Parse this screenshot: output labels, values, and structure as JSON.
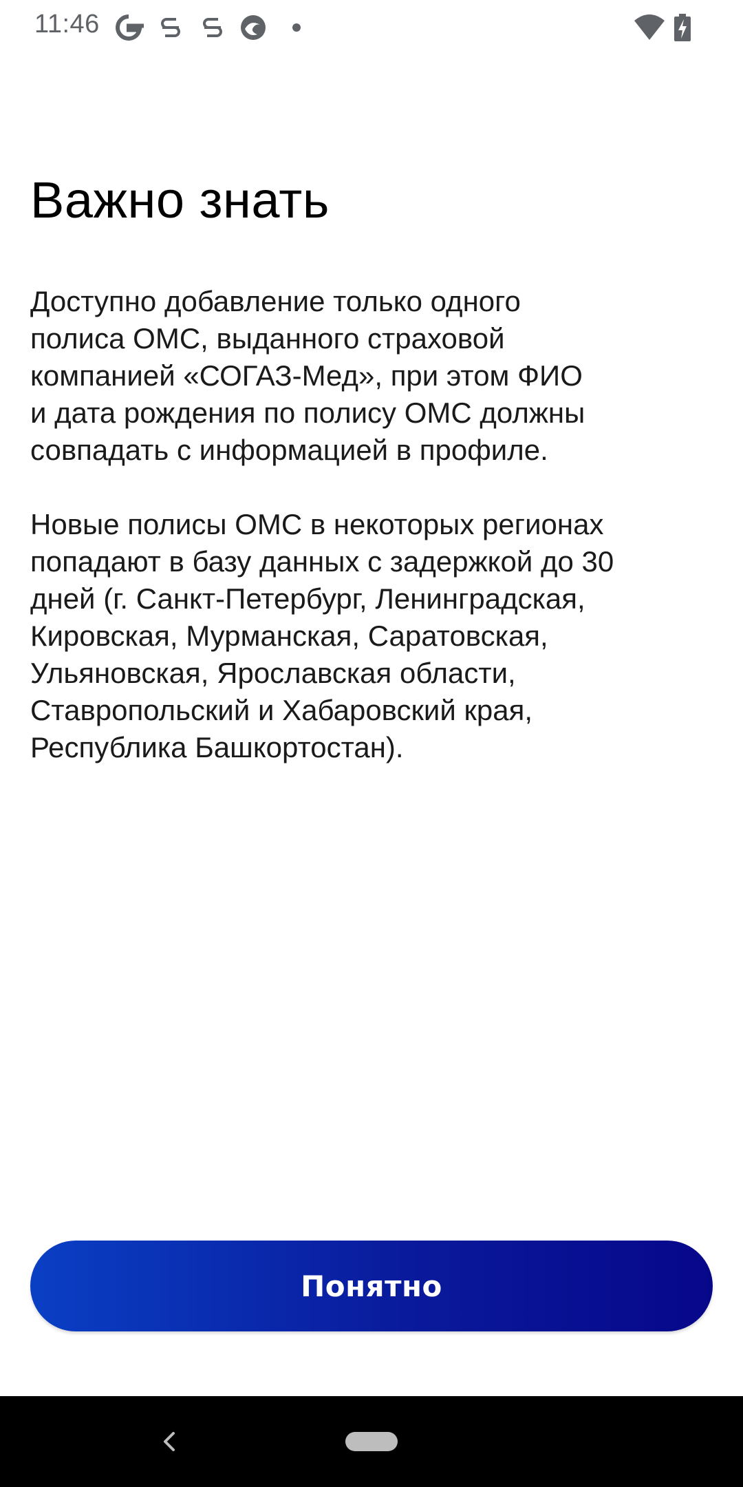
{
  "status_bar": {
    "time": "11:46",
    "icons": [
      "google-icon",
      "s-app-icon",
      "s-app-icon",
      "edge-icon",
      "notification-dot-icon",
      "wifi-icon",
      "battery-charging-icon"
    ]
  },
  "screen": {
    "title": "Важно знать",
    "paragraph_1": "Доступно добавление только одного\nполиса ОМС, выданного страховой\nкомпанией «СОГАЗ-Мед», при этом ФИО\nи дата рождения по полису ОМС должны\nсовпадать с информацией в профиле.",
    "paragraph_2": "Новые полисы ОМС в некоторых регионах\nпопадают в базу данных с задержкой до 30\nдней (г. Санкт-Петербург, Ленинградская,\nКировская, Мурманская, Саратовская,\nУльяновская, Ярославская области,\nСтавропольский и Хабаровский края,\nРеспублика Башкортостан).",
    "button_label": "Понятно"
  },
  "colors": {
    "button_gradient_start": "#0a3fc4",
    "button_gradient_end": "#07078a",
    "status_icon": "#5f6368",
    "nav_bar": "#000000"
  }
}
